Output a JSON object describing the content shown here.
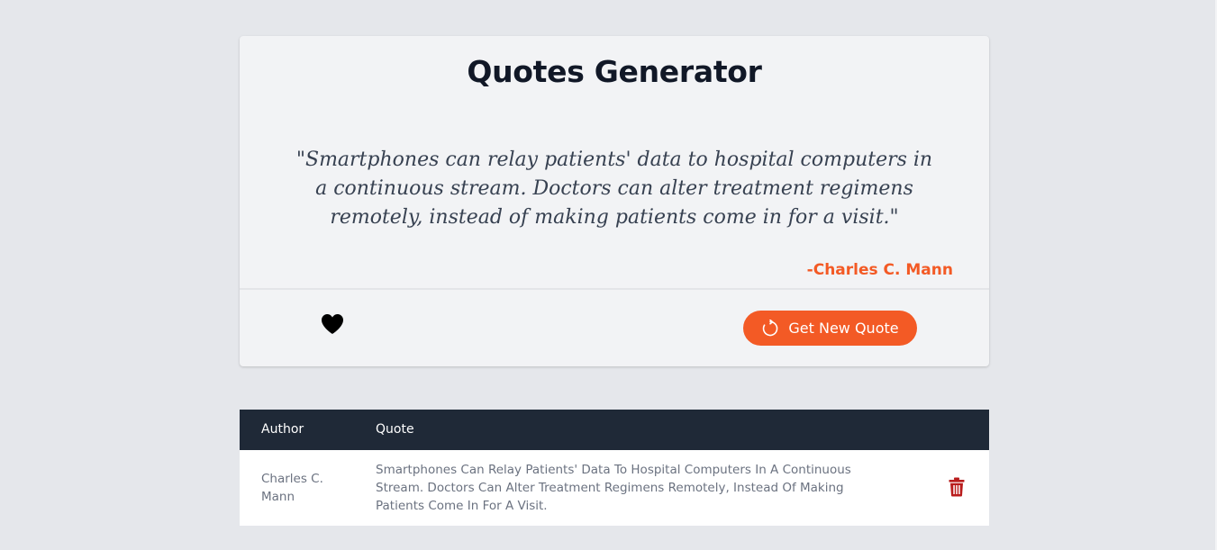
{
  "card": {
    "title": "Quotes Generator",
    "quote": "\"Smartphones can relay patients' data to hospital computers in a continuous stream. Doctors can alter treatment regimens remotely, instead of making patients come in for a visit.\"",
    "author": "-Charles C. Mann",
    "heart_icon": "heart-icon",
    "new_quote_label": "Get New Quote",
    "refresh_icon": "refresh-icon"
  },
  "table": {
    "headers": [
      "Author",
      "Quote"
    ],
    "rows": [
      {
        "author": "Charles C. Mann",
        "quote": "Smartphones Can Relay Patients' Data To Hospital Computers In A Continuous Stream. Doctors Can Alter Treatment Regimens Remotely, Instead Of Making Patients Come In For A Visit.",
        "delete_icon": "trash-icon"
      }
    ]
  },
  "colors": {
    "accent": "#f35a25",
    "header_bg": "#1f2937",
    "delete": "#b91c1c",
    "page_bg": "#e5e7eb"
  }
}
